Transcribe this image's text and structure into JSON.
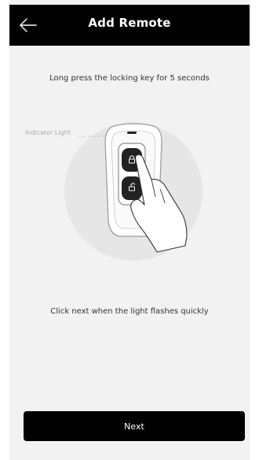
{
  "header": {
    "title": "Add Remote",
    "back_icon": "arrow-left-icon"
  },
  "instructions": {
    "top": "Long press the locking key for 5 seconds",
    "bottom": "Click next when the light flashes quickly"
  },
  "illustration": {
    "indicator_label": "Indicator Light",
    "lock_icon": "lock-icon",
    "unlock_icon": "unlock-icon"
  },
  "actions": {
    "next_label": "Next"
  },
  "colors": {
    "header_bg": "#000000",
    "page_bg": "#f2f2f2",
    "button_bg": "#000000",
    "button_text": "#ffffff"
  }
}
